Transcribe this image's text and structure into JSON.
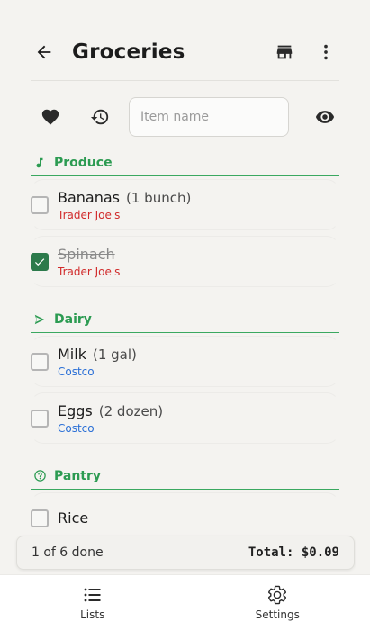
{
  "header": {
    "title": "Groceries",
    "back_icon": "arrow-left-icon",
    "store_icon": "store-icon",
    "menu_icon": "more-vertical-icon"
  },
  "toolbar": {
    "favorites_icon": "heart-icon",
    "history_icon": "history-icon",
    "input_placeholder": "Item name",
    "input_value": "",
    "visibility_icon": "eye-icon"
  },
  "sections": [
    {
      "name": "Produce",
      "icon": "music-note-icon",
      "items": [
        {
          "name": "Bananas",
          "qty": "(1 bunch)",
          "store": "Trader Joe's",
          "checked": false
        },
        {
          "name": "Spinach",
          "qty": "",
          "store": "Trader Joe's",
          "checked": true
        }
      ]
    },
    {
      "name": "Dairy",
      "icon": "send-icon",
      "items": [
        {
          "name": "Milk",
          "qty": "(1 gal)",
          "store": "Costco",
          "checked": false
        },
        {
          "name": "Eggs",
          "qty": "(2 dozen)",
          "store": "Costco",
          "checked": false
        }
      ]
    },
    {
      "name": "Pantry",
      "icon": "help-circle-icon",
      "items": [
        {
          "name": "Rice",
          "qty": "",
          "store": "",
          "checked": false
        }
      ]
    }
  ],
  "status": {
    "done_text": "1 of 6 done",
    "total_text": "Total: $0.09"
  },
  "nav": {
    "lists_label": "Lists",
    "settings_label": "Settings"
  },
  "colors": {
    "accent_green": "#2c9b52",
    "checked_green": "#2c7a4b",
    "trader_joes_red": "#d12b2b",
    "costco_blue": "#2a6fd6"
  }
}
